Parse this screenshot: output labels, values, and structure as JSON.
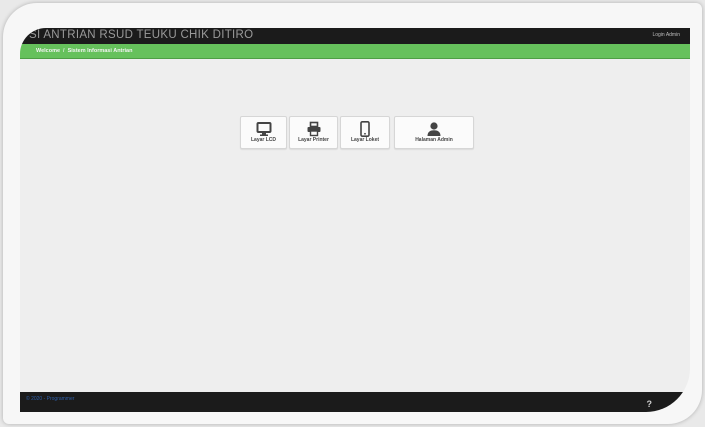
{
  "header": {
    "app_title": "SI ANTRIAN RSUD TEUKU CHIK DITIRO",
    "login_label": "Login Admin"
  },
  "breadcrumb": {
    "home": "Welcome",
    "separator": "/",
    "current": "Sistem Informasi Antrian"
  },
  "menu": [
    {
      "label": "Layar LCD",
      "icon": "monitor-icon"
    },
    {
      "label": "Layar Printer",
      "icon": "printer-icon"
    },
    {
      "label": "Layar Loket",
      "icon": "mobile-icon"
    },
    {
      "label": "Halaman Admin",
      "icon": "user-icon"
    }
  ],
  "footer": {
    "copyright": "© 2020 - Programmer",
    "help": "?"
  },
  "colors": {
    "topbar": "#1b1b1b",
    "breadcrumb_bar": "#66c15c",
    "icon": "#444444"
  }
}
